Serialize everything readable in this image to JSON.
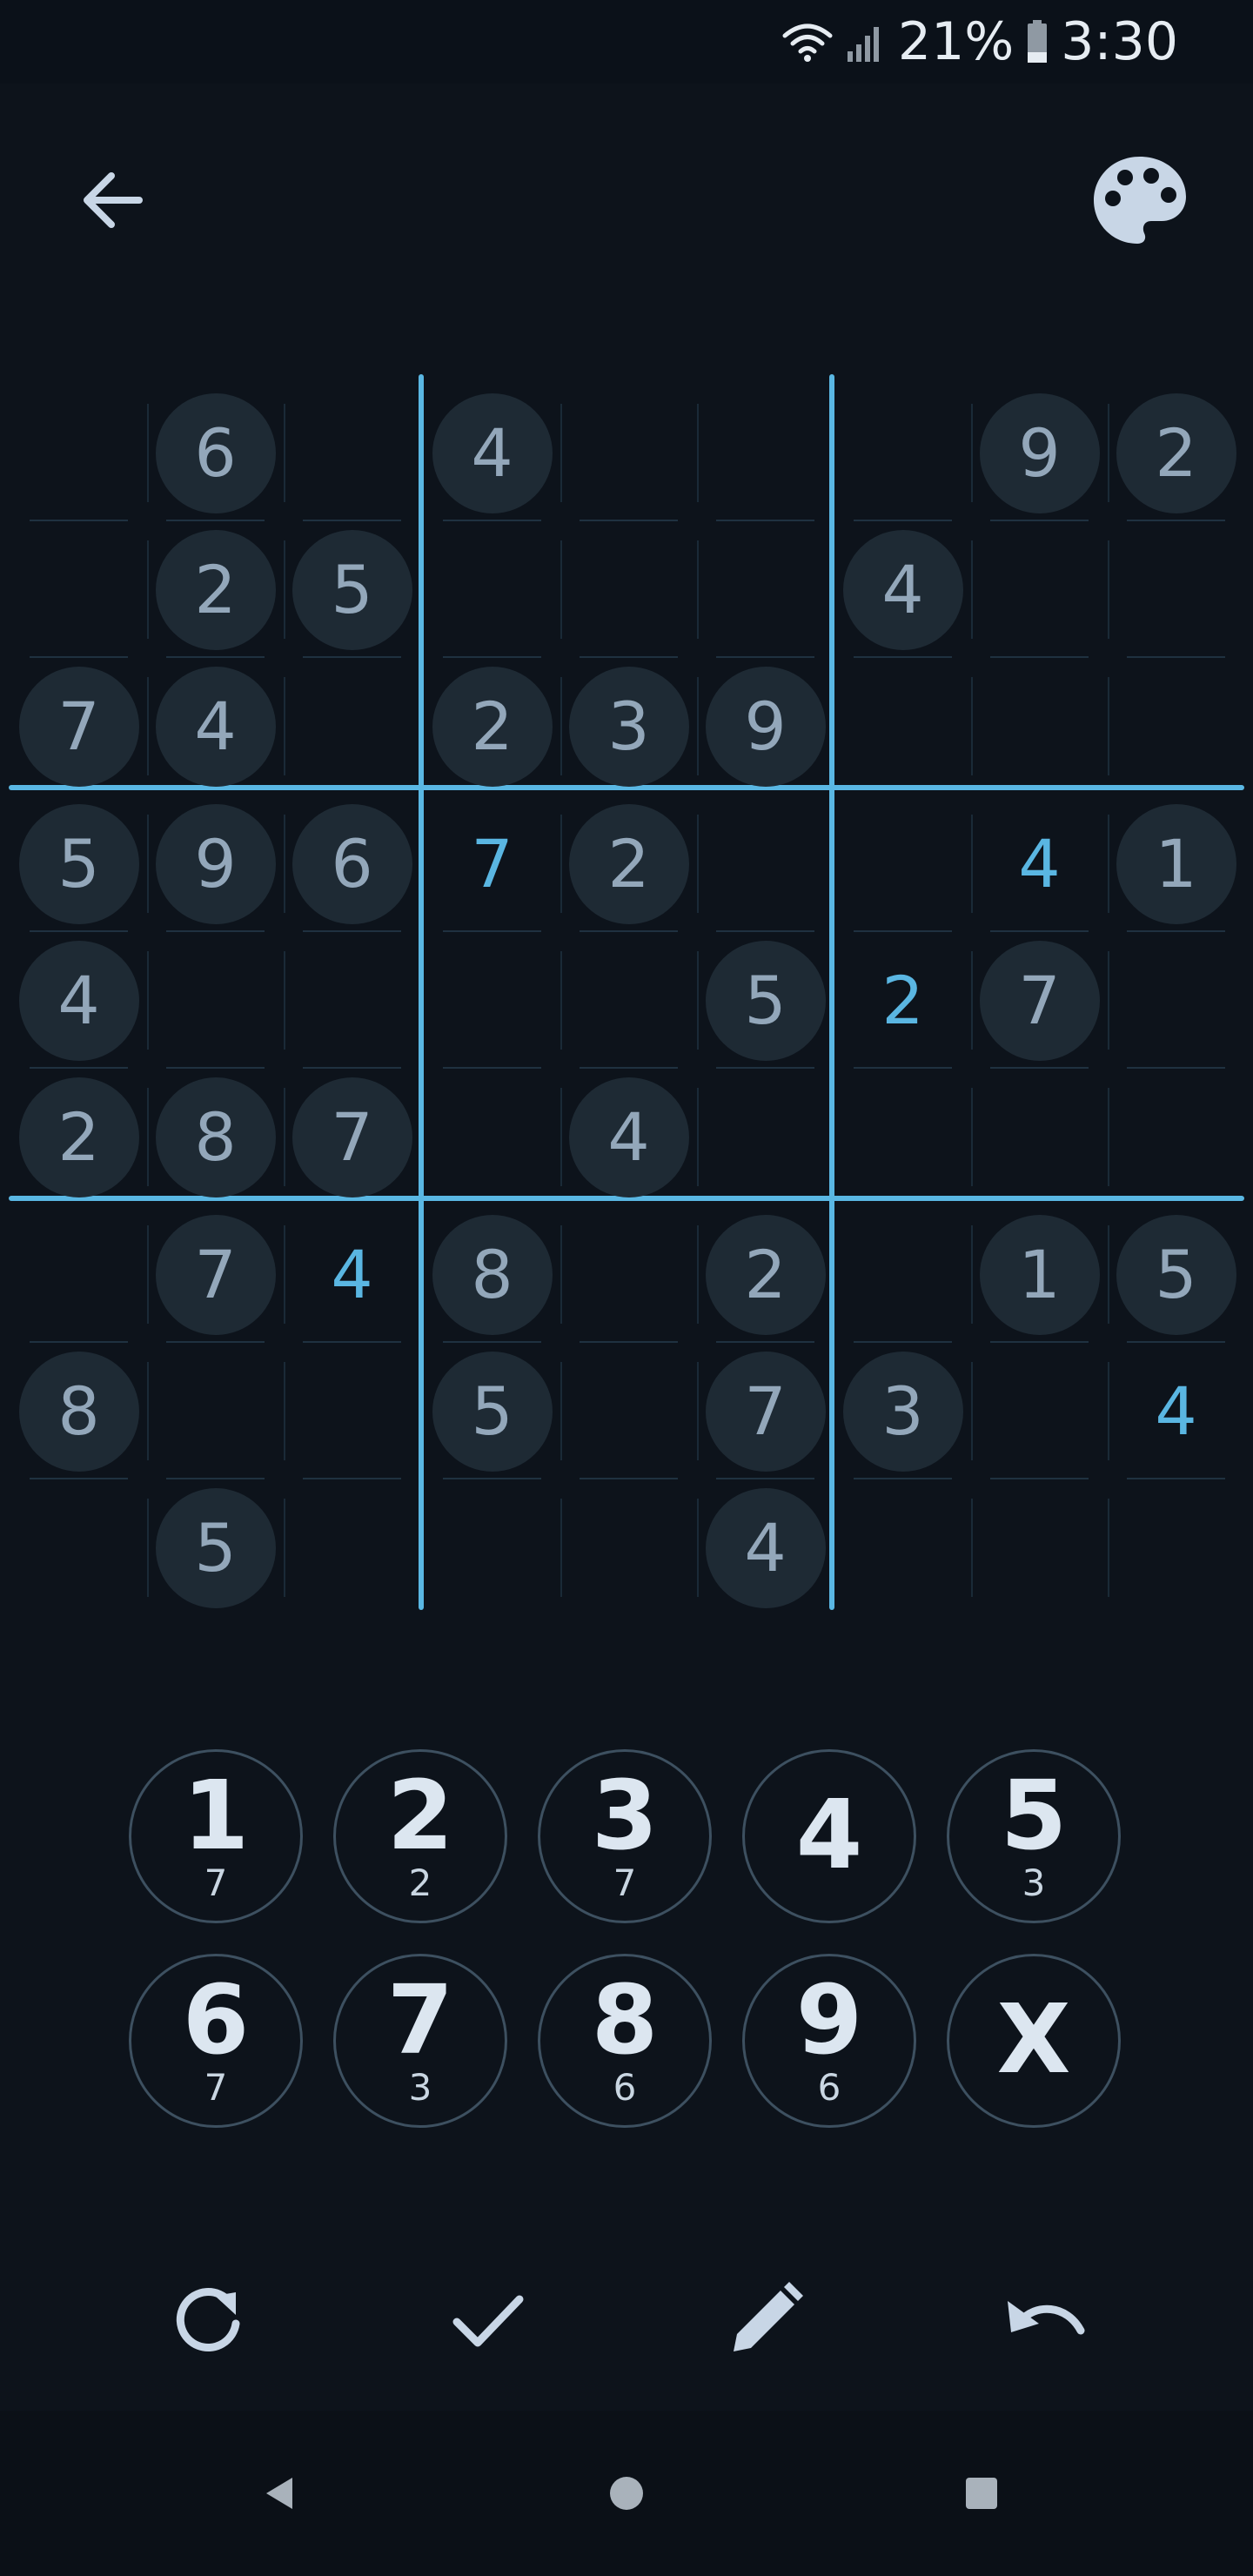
{
  "status_bar": {
    "battery_percent": "21%",
    "time": "3:30",
    "icons": [
      "wifi-icon",
      "signal-icon",
      "battery-icon"
    ]
  },
  "top_bar": {
    "back_icon": "arrow-left-icon",
    "theme_icon": "palette-icon"
  },
  "colors": {
    "background": "#0d131b",
    "given_digit": "#93a7ba",
    "given_circle": "#1e2a34",
    "user_digit": "#5ab6e2",
    "box_lines": "#5ab7e3",
    "icon": "#c8d6e6"
  },
  "board": {
    "rows": [
      [
        "",
        "6",
        "",
        "4",
        "",
        "",
        "",
        "9",
        "2"
      ],
      [
        "",
        "2",
        "5",
        "",
        "",
        "",
        "4",
        "",
        ""
      ],
      [
        "7",
        "4",
        "",
        "2",
        "3",
        "9",
        "",
        "",
        ""
      ],
      [
        "5",
        "9",
        "6",
        "7",
        "2",
        "",
        "",
        "4",
        "1"
      ],
      [
        "4",
        "",
        "",
        "",
        "",
        "5",
        "2",
        "7",
        ""
      ],
      [
        "2",
        "8",
        "7",
        "",
        "4",
        "",
        "",
        "",
        ""
      ],
      [
        "",
        "7",
        "4",
        "8",
        "",
        "2",
        "",
        "1",
        "5"
      ],
      [
        "8",
        "",
        "",
        "5",
        "",
        "7",
        "3",
        "",
        "4"
      ],
      [
        "",
        "5",
        "",
        "",
        "",
        "4",
        "",
        "",
        ""
      ]
    ],
    "user_entries": [
      [
        3,
        3
      ],
      [
        3,
        7
      ],
      [
        4,
        6
      ],
      [
        6,
        2
      ],
      [
        7,
        8
      ]
    ]
  },
  "keypad": {
    "keys": [
      {
        "label": "1",
        "count": "7"
      },
      {
        "label": "2",
        "count": "2"
      },
      {
        "label": "3",
        "count": "7"
      },
      {
        "label": "4",
        "count": ""
      },
      {
        "label": "5",
        "count": "3"
      },
      {
        "label": "6",
        "count": "7"
      },
      {
        "label": "7",
        "count": "3"
      },
      {
        "label": "8",
        "count": "6"
      },
      {
        "label": "9",
        "count": "6"
      },
      {
        "label": "X",
        "count": ""
      }
    ]
  },
  "toolbar": {
    "icons": [
      "refresh-icon",
      "check-icon",
      "pencil-icon",
      "undo-icon"
    ]
  },
  "nav_bar": {
    "icons": [
      "nav-back-icon",
      "nav-home-icon",
      "nav-recents-icon"
    ]
  }
}
